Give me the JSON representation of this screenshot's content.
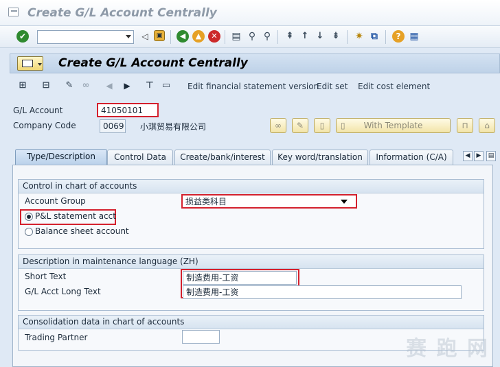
{
  "window": {
    "title": "Create G/L Account Centrally"
  },
  "toolbar": {
    "command_field": "",
    "icons": [
      "enter-icon",
      "back-icon",
      "save-icon",
      "exit-icon",
      "cancel-icon",
      "print-icon",
      "find-icon",
      "find-next-icon",
      "first-page-icon",
      "previous-page-icon",
      "next-page-icon",
      "last-page-icon",
      "new-session-icon",
      "shortcut-icon",
      "help-icon",
      "customize-layout-icon"
    ]
  },
  "screen": {
    "title": "Create G/L Account Centrally",
    "app_toolbar": {
      "edit_fs_version": "Edit financial statement version",
      "edit_set": "Edit set",
      "edit_cost_element": "Edit cost element"
    }
  },
  "header": {
    "gl_account_label": "G/L Account",
    "gl_account_value": "41050101",
    "company_code_label": "Company Code",
    "company_code_value": "0069",
    "company_name": "小琪贸易有限公司",
    "with_template": "With Template"
  },
  "tabs": [
    {
      "label": "Type/Description",
      "active": true
    },
    {
      "label": "Control Data",
      "active": false
    },
    {
      "label": "Create/bank/interest",
      "active": false
    },
    {
      "label": "Key word/translation",
      "active": false
    },
    {
      "label": "Information (C/A)",
      "active": false
    }
  ],
  "coa_group": {
    "title": "Control in chart of accounts",
    "account_group_label": "Account Group",
    "account_group_value": "损益类科目",
    "pl_label": "P&L statement acct",
    "bs_label": "Balance sheet account",
    "selected": "pl"
  },
  "desc_group": {
    "title": "Description in maintenance language (ZH)",
    "short_text_label": "Short Text",
    "short_text_value": "制造费用-工资",
    "long_text_label": "G/L Acct Long Text",
    "long_text_value": "制造费用-工资"
  },
  "consol_group": {
    "title": "Consolidation data in chart of accounts",
    "trading_partner_label": "Trading Partner",
    "trading_partner_value": ""
  },
  "watermark": "赛 跑 网"
}
